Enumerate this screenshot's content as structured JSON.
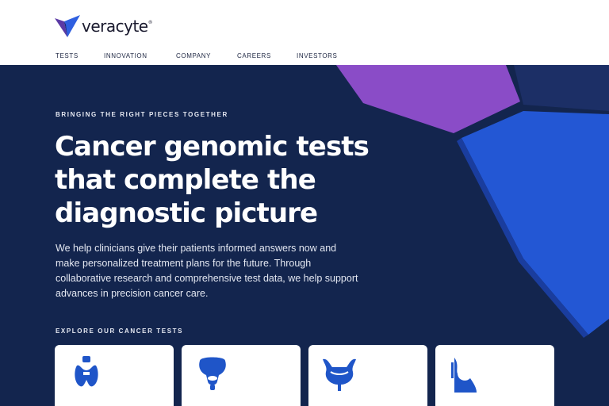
{
  "brand": {
    "name": "veracyte",
    "mark": "®",
    "colors": {
      "navy": "#13254e",
      "blue": "#1f55c8",
      "purple": "#8a4cc7",
      "accent_blue": "#2f5fe0"
    }
  },
  "nav": {
    "items": [
      {
        "label": "TESTS"
      },
      {
        "label": "INNOVATION"
      },
      {
        "label": "COMPANY"
      },
      {
        "label": "CAREERS"
      },
      {
        "label": "INVESTORS"
      }
    ]
  },
  "hero": {
    "eyebrow": "BRINGING THE RIGHT PIECES TOGETHER",
    "headline_lines": [
      "Cancer genomic tests",
      "that complete the",
      "diagnostic picture"
    ],
    "intro_lines": [
      "We help clinicians give their patients informed answers now and",
      "make personalized treatment plans for the future. Through",
      "collaborative research and comprehensive test data, we help support",
      "advances in precision cancer care."
    ],
    "explore_label": "EXPLORE OUR CANCER TESTS"
  },
  "test_cards": [
    {
      "icon": "thyroid-icon"
    },
    {
      "icon": "prostate-icon"
    },
    {
      "icon": "bladder-icon"
    },
    {
      "icon": "breast-icon"
    }
  ]
}
